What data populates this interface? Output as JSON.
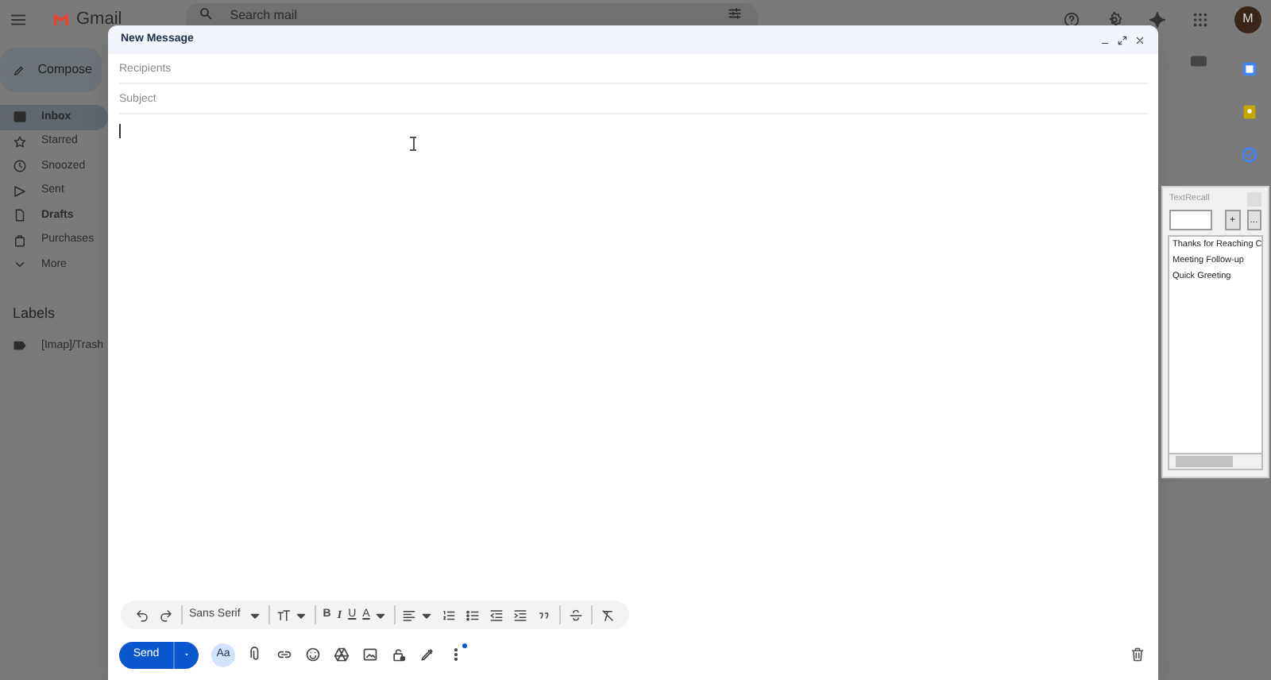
{
  "topbar": {
    "logo_text": "Gmail",
    "search_placeholder": "Search mail",
    "avatar_letter": "M"
  },
  "compose_button": "Compose",
  "nav": [
    {
      "label": "Inbox",
      "kind": "inbox",
      "selected": true,
      "unread": true
    },
    {
      "label": "Starred",
      "kind": "star",
      "selected": false,
      "unread": false
    },
    {
      "label": "Snoozed",
      "kind": "clock",
      "selected": false,
      "unread": false
    },
    {
      "label": "Sent",
      "kind": "sent",
      "selected": false,
      "unread": false
    },
    {
      "label": "Drafts",
      "kind": "file",
      "selected": false,
      "unread": true
    },
    {
      "label": "Purchases",
      "kind": "bag",
      "selected": false,
      "unread": false
    },
    {
      "label": "More",
      "kind": "chevron",
      "selected": false,
      "unread": false
    }
  ],
  "labels_heading": "Labels",
  "labels": [
    {
      "label": "[Imap]/Trash"
    }
  ],
  "compose": {
    "title": "New Message",
    "recipients_placeholder": "Recipients",
    "subject_placeholder": "Subject",
    "format_groups": [
      [
        {
          "kind": "undo"
        },
        {
          "kind": "redo"
        }
      ],
      [
        {
          "kind": "font",
          "label": "Sans Serif"
        }
      ],
      [
        {
          "kind": "size"
        }
      ],
      [
        {
          "kind": "bold",
          "label": "B"
        },
        {
          "kind": "italic",
          "label": "I"
        },
        {
          "kind": "underline",
          "label": "U"
        },
        {
          "kind": "color",
          "label": "A"
        }
      ],
      [
        {
          "kind": "align"
        },
        {
          "kind": "numbered"
        },
        {
          "kind": "bulleted"
        },
        {
          "kind": "outdent"
        },
        {
          "kind": "indent"
        },
        {
          "kind": "quote"
        }
      ],
      [
        {
          "kind": "strike"
        }
      ],
      [
        {
          "kind": "clear"
        }
      ]
    ],
    "send_label": "Send",
    "format_label": "Aa"
  },
  "textrecall": {
    "title": "TextRecall",
    "add_label": "+",
    "more_label": "...",
    "items": [
      {
        "label": "Thanks for Reaching C"
      },
      {
        "label": "Meeting Follow-up"
      },
      {
        "label": "Quick Greeting"
      }
    ]
  }
}
